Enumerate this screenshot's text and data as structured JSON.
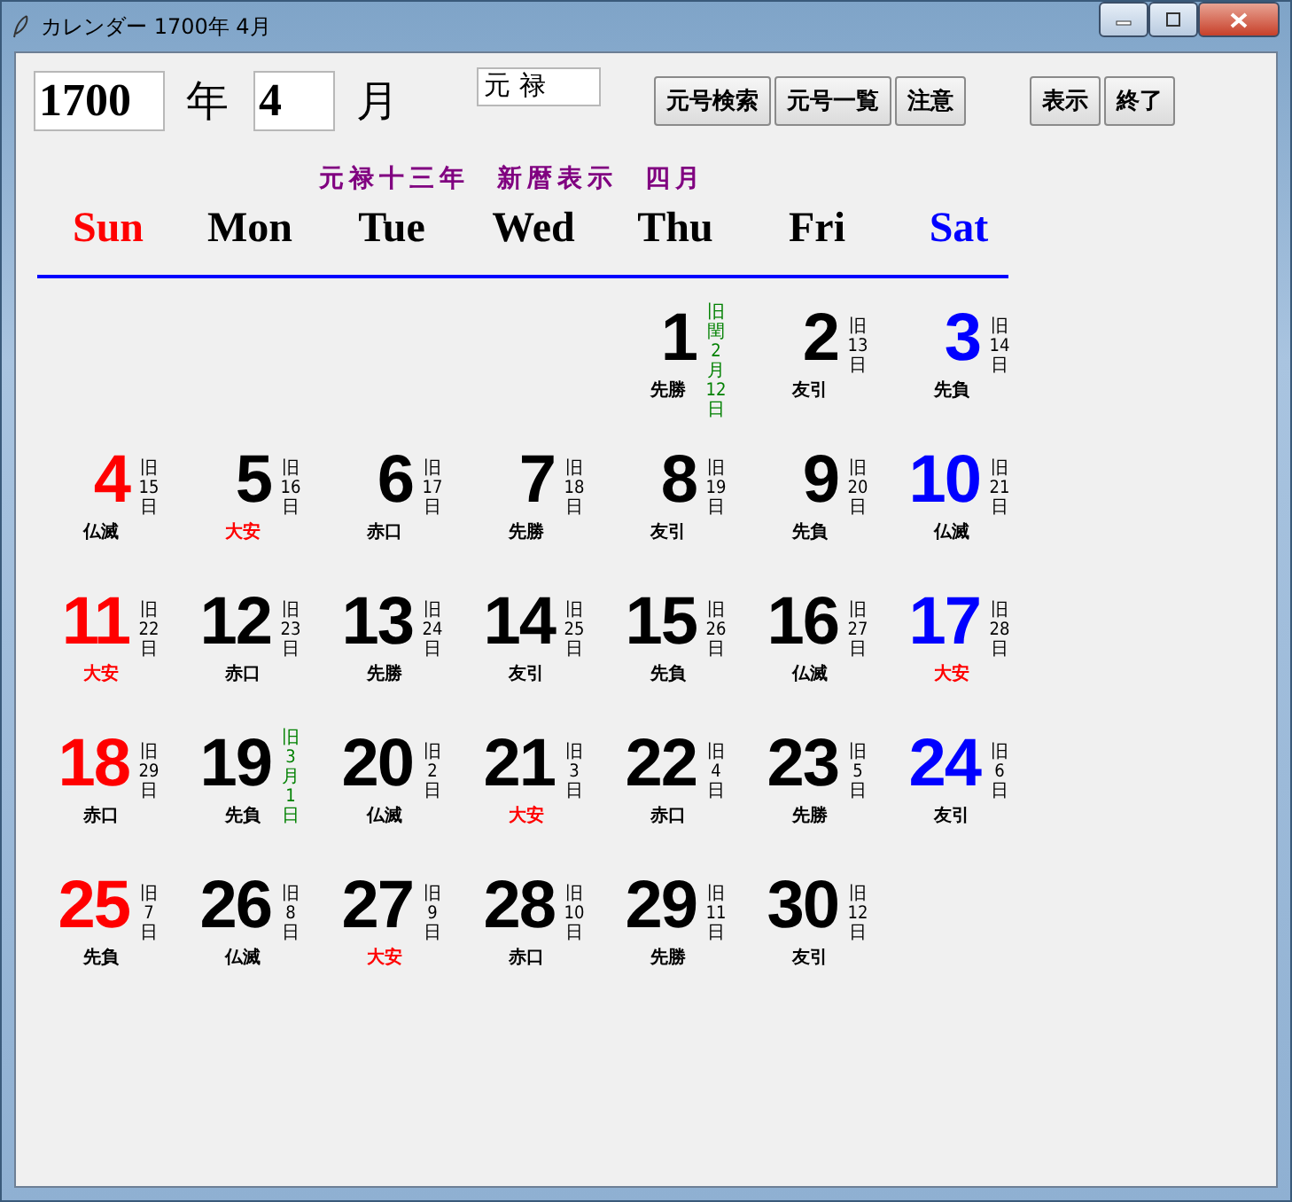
{
  "window": {
    "title": "カレンダー 1700年  4月"
  },
  "toolbar": {
    "year": "1700",
    "year_label": "年",
    "month": "4",
    "month_label": "月",
    "era": "元 禄",
    "buttons": [
      "元号検索",
      "元号一覧",
      "注意"
    ],
    "right_buttons": [
      "表示",
      "終了"
    ]
  },
  "heading": "元禄十三年  新暦表示  四月",
  "weekdays": [
    "Sun",
    "Mon",
    "Tue",
    "Wed",
    "Thu",
    "Fri",
    "Sat"
  ],
  "weeks": [
    [
      {
        "day": "1",
        "kind": "month-start",
        "old": [
          "旧",
          "閏",
          "2",
          "月",
          "12",
          "日"
        ],
        "rokuyo": "先勝",
        "color": "#000000"
      },
      {
        "day": "2",
        "kind": "normal",
        "old": [
          "旧",
          "13",
          "日"
        ],
        "rokuyo": "友引",
        "color": "#000000"
      },
      {
        "day": "3",
        "kind": "normal",
        "old": [
          "旧",
          "14",
          "日"
        ],
        "rokuyo": "先負",
        "color": "#000000"
      }
    ],
    [
      {
        "day": "4",
        "kind": "normal",
        "old": [
          "旧",
          "15",
          "日"
        ],
        "rokuyo": "仏滅",
        "color": "#000000"
      },
      {
        "day": "5",
        "kind": "normal",
        "old": [
          "旧",
          "16",
          "日"
        ],
        "rokuyo": "大安",
        "color": "#ff0000"
      },
      {
        "day": "6",
        "kind": "normal",
        "old": [
          "旧",
          "17",
          "日"
        ],
        "rokuyo": "赤口",
        "color": "#000000"
      },
      {
        "day": "7",
        "kind": "normal",
        "old": [
          "旧",
          "18",
          "日"
        ],
        "rokuyo": "先勝",
        "color": "#000000"
      },
      {
        "day": "8",
        "kind": "normal",
        "old": [
          "旧",
          "19",
          "日"
        ],
        "rokuyo": "友引",
        "color": "#000000"
      },
      {
        "day": "9",
        "kind": "normal",
        "old": [
          "旧",
          "20",
          "日"
        ],
        "rokuyo": "先負",
        "color": "#000000"
      },
      {
        "day": "10",
        "kind": "normal",
        "old": [
          "旧",
          "21",
          "日"
        ],
        "rokuyo": "仏滅",
        "color": "#000000"
      }
    ],
    [
      {
        "day": "11",
        "kind": "normal",
        "old": [
          "旧",
          "22",
          "日"
        ],
        "rokuyo": "大安",
        "color": "#ff0000"
      },
      {
        "day": "12",
        "kind": "normal",
        "old": [
          "旧",
          "23",
          "日"
        ],
        "rokuyo": "赤口",
        "color": "#000000"
      },
      {
        "day": "13",
        "kind": "normal",
        "old": [
          "旧",
          "24",
          "日"
        ],
        "rokuyo": "先勝",
        "color": "#000000"
      },
      {
        "day": "14",
        "kind": "normal",
        "old": [
          "旧",
          "25",
          "日"
        ],
        "rokuyo": "友引",
        "color": "#000000"
      },
      {
        "day": "15",
        "kind": "normal",
        "old": [
          "旧",
          "26",
          "日"
        ],
        "rokuyo": "先負",
        "color": "#000000"
      },
      {
        "day": "16",
        "kind": "normal",
        "old": [
          "旧",
          "27",
          "日"
        ],
        "rokuyo": "仏滅",
        "color": "#000000"
      },
      {
        "day": "17",
        "kind": "normal",
        "old": [
          "旧",
          "28",
          "日"
        ],
        "rokuyo": "大安",
        "color": "#ff0000"
      }
    ],
    [
      {
        "day": "18",
        "kind": "normal",
        "old": [
          "旧",
          "29",
          "日"
        ],
        "rokuyo": "赤口",
        "color": "#000000"
      },
      {
        "day": "19",
        "kind": "month-start",
        "old": [
          "旧",
          "3",
          "月",
          "1",
          "日"
        ],
        "rokuyo": "先負",
        "color": "#000000"
      },
      {
        "day": "20",
        "kind": "normal",
        "old": [
          "旧",
          "2",
          "日"
        ],
        "rokuyo": "仏滅",
        "color": "#000000"
      },
      {
        "day": "21",
        "kind": "normal",
        "old": [
          "旧",
          "3",
          "日"
        ],
        "rokuyo": "大安",
        "color": "#ff0000"
      },
      {
        "day": "22",
        "kind": "normal",
        "old": [
          "旧",
          "4",
          "日"
        ],
        "rokuyo": "赤口",
        "color": "#000000"
      },
      {
        "day": "23",
        "kind": "normal",
        "old": [
          "旧",
          "5",
          "日"
        ],
        "rokuyo": "先勝",
        "color": "#000000"
      },
      {
        "day": "24",
        "kind": "normal",
        "old": [
          "旧",
          "6",
          "日"
        ],
        "rokuyo": "友引",
        "color": "#000000"
      }
    ],
    [
      {
        "day": "25",
        "kind": "normal",
        "old": [
          "旧",
          "7",
          "日"
        ],
        "rokuyo": "先負",
        "color": "#000000"
      },
      {
        "day": "26",
        "kind": "normal",
        "old": [
          "旧",
          "8",
          "日"
        ],
        "rokuyo": "仏滅",
        "color": "#000000"
      },
      {
        "day": "27",
        "kind": "normal",
        "old": [
          "旧",
          "9",
          "日"
        ],
        "rokuyo": "大安",
        "color": "#ff0000"
      },
      {
        "day": "28",
        "kind": "normal",
        "old": [
          "旧",
          "10",
          "日"
        ],
        "rokuyo": "赤口",
        "color": "#000000"
      },
      {
        "day": "29",
        "kind": "normal",
        "old": [
          "旧",
          "11",
          "日"
        ],
        "rokuyo": "先勝",
        "color": "#000000"
      },
      {
        "day": "30",
        "kind": "normal",
        "old": [
          "旧",
          "12",
          "日"
        ],
        "rokuyo": "友引",
        "color": "#000000"
      }
    ]
  ]
}
